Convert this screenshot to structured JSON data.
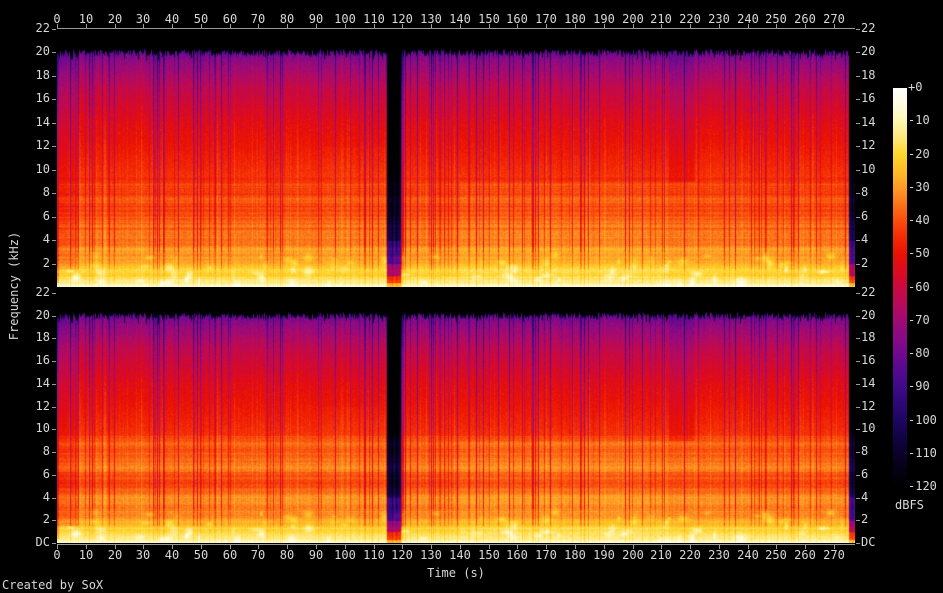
{
  "footer": {
    "credit": "Created by SoX"
  },
  "axes": {
    "time_label": "Time (s)",
    "freq_label": "Frequency (kHz)",
    "colorbar_label": "dBFS",
    "dc_label": "DC",
    "time_ticks": [
      0,
      10,
      20,
      30,
      40,
      50,
      60,
      70,
      80,
      90,
      100,
      110,
      120,
      130,
      140,
      150,
      160,
      170,
      180,
      190,
      200,
      210,
      220,
      230,
      240,
      250,
      260,
      270
    ],
    "freq_ticks_khz": [
      22,
      20,
      18,
      16,
      14,
      12,
      10,
      8,
      6,
      4,
      2
    ],
    "colorbar_ticks": [
      "+0",
      "-10",
      "-20",
      "-30",
      "-40",
      "-50",
      "-60",
      "-70",
      "-80",
      "-90",
      "-100",
      "-110",
      "-120"
    ]
  },
  "colors": {
    "background": "#000000",
    "axis": "#9a9a9a",
    "text": "#d8d8d8"
  },
  "chart_data": {
    "type": "heatmap",
    "subtype": "audio-spectrogram",
    "channels": 2,
    "time_range": [
      0,
      277.4
    ],
    "freq_range_khz": [
      0,
      22
    ],
    "level_range_dbfs": [
      0,
      -120
    ],
    "pixels_per_second": 2.8778,
    "notable_features": [
      "stereo: two stacked channel spectrograms with nearly identical content",
      "silent gap between tracks at about 115-119 s (dark blue/black column)",
      "fade-out / silence after about 275 s at the right edge",
      "bright full-scale low-frequency band along the bottom of each channel",
      "high-frequency content cuts off near 20.4 kHz (black band above)",
      "dense vertical striations from note/beat onsets throughout"
    ],
    "palette_dbfs_hex": [
      [
        0,
        "#ffffff"
      ],
      [
        -5,
        "#fffbe0"
      ],
      [
        -10,
        "#fdf6b0"
      ],
      [
        -15,
        "#fee77a"
      ],
      [
        -20,
        "#fed62c"
      ],
      [
        -25,
        "#ffbc26"
      ],
      [
        -30,
        "#fe9c27"
      ],
      [
        -35,
        "#fb7318"
      ],
      [
        -40,
        "#f94d0c"
      ],
      [
        -45,
        "#f42a05"
      ],
      [
        -50,
        "#e91104"
      ],
      [
        -55,
        "#dc0b20"
      ],
      [
        -60,
        "#c90940"
      ],
      [
        -65,
        "#b70b5c"
      ],
      [
        -70,
        "#a00a74"
      ],
      [
        -75,
        "#8a0a85"
      ],
      [
        -80,
        "#6f098f"
      ],
      [
        -85,
        "#55098f"
      ],
      [
        -90,
        "#3f0a86"
      ],
      [
        -95,
        "#2d0875"
      ],
      [
        -100,
        "#1d0560"
      ],
      [
        -105,
        "#130343"
      ],
      [
        -110,
        "#0b022b"
      ],
      [
        -115,
        "#050114"
      ],
      [
        -120,
        "#000000"
      ]
    ],
    "base_curve": [
      [
        0,
        -6
      ],
      [
        0.15,
        -8
      ],
      [
        0.35,
        -14
      ],
      [
        0.7,
        -19
      ],
      [
        1,
        -22
      ],
      [
        1.5,
        -25
      ],
      [
        2,
        -27
      ],
      [
        3,
        -31
      ],
      [
        4,
        -34
      ],
      [
        5,
        -36
      ],
      [
        6,
        -38
      ],
      [
        8,
        -41
      ],
      [
        10,
        -45
      ],
      [
        12,
        -49
      ],
      [
        14,
        -53
      ],
      [
        16,
        -59
      ],
      [
        17,
        -62
      ],
      [
        18,
        -67
      ],
      [
        19,
        -72
      ],
      [
        19.7,
        -77
      ],
      [
        20.1,
        -82
      ],
      [
        20.45,
        -96
      ],
      [
        20.6,
        -120
      ],
      [
        22,
        -120
      ]
    ],
    "segments": [
      {
        "t0": 0,
        "t1": 0.35,
        "db": -10,
        "fmin": 0.4,
        "fmax": 22
      },
      {
        "t0": 0.35,
        "t1": 7.2,
        "db": -5,
        "fmin": 1.5,
        "fmax": 22
      },
      {
        "t0": 92,
        "t1": 114.6,
        "db": 1,
        "fmin": 2,
        "fmax": 12
      },
      {
        "t0": 140,
        "t1": 212,
        "db": 2,
        "fmin": 0.8,
        "fmax": 9
      },
      {
        "t0": 212.5,
        "t1": 221.5,
        "db": -5,
        "fmin": 9,
        "fmax": 20.6
      }
    ],
    "quiet_regions": [
      {
        "t0": 114.7,
        "t1": 119.2,
        "depth": -62
      },
      {
        "t0": 275.3,
        "t1": 277.4,
        "depth": -60
      }
    ],
    "noise": {
      "seed": 20131117,
      "column_jitter_db": 4,
      "dark_line_probability": 0.17,
      "dark_line_max_db": 21,
      "pixel_noise_db": 4.5,
      "hf_speckle_db": 6,
      "cutoff_khz": [
        19.95,
        20.55
      ],
      "blob_count": 90
    }
  }
}
